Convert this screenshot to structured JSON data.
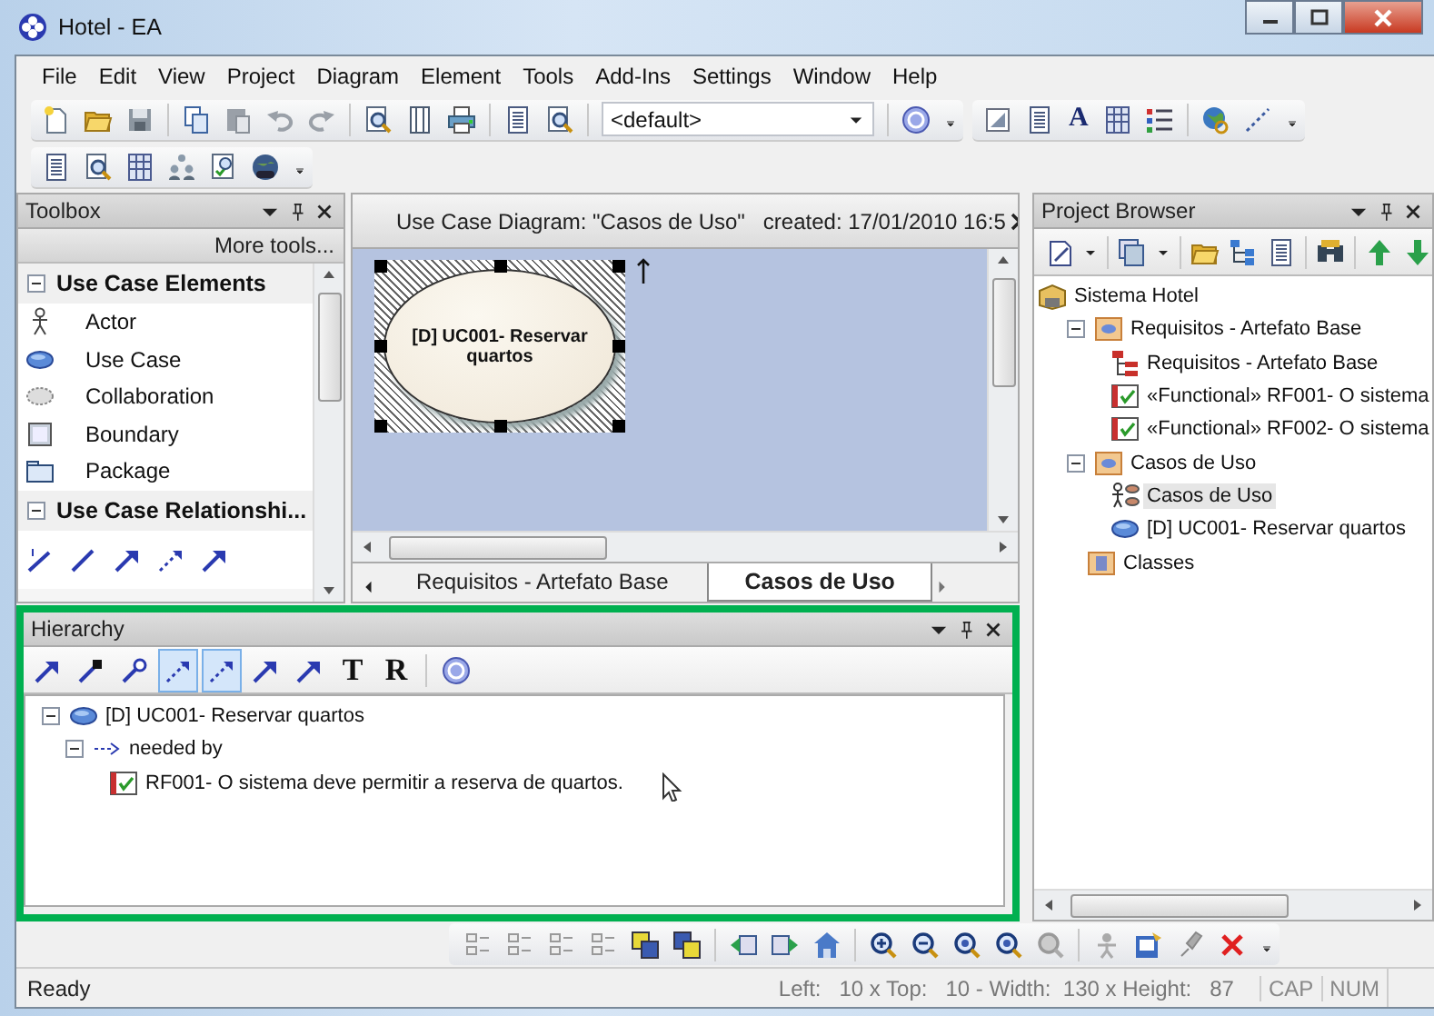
{
  "window": {
    "title": "Hotel - EA"
  },
  "menu": [
    "File",
    "Edit",
    "View",
    "Project",
    "Diagram",
    "Element",
    "Tools",
    "Add-Ins",
    "Settings",
    "Window",
    "Help"
  ],
  "toolbar": {
    "perspective": {
      "value": "<default>"
    },
    "letter_button": "A"
  },
  "toolbox": {
    "title": "Toolbox",
    "more_tools": "More tools...",
    "sections": [
      {
        "title": "Use Case Elements",
        "expanded": true,
        "items": [
          {
            "label": "Actor",
            "kind": "actor"
          },
          {
            "label": "Use Case",
            "kind": "usecase"
          },
          {
            "label": "Collaboration",
            "kind": "collaboration"
          },
          {
            "label": "Boundary",
            "kind": "boundary"
          },
          {
            "label": "Package",
            "kind": "package"
          }
        ]
      },
      {
        "title": "Use Case Relationshi...",
        "expanded": true
      }
    ]
  },
  "diagram": {
    "title": "Use Case Diagram: \"Casos de Uso\"   created: 17/01/2010 16:5",
    "element": {
      "label": "[D] UC001- Reservar quartos",
      "selected": true
    },
    "tabs": [
      {
        "label": "Requisitos - Artefato Base",
        "selected": false
      },
      {
        "label": "Casos de Uso",
        "selected": true
      }
    ]
  },
  "project_browser": {
    "title": "Project Browser",
    "tree": [
      {
        "label": "Sistema Hotel",
        "kind": "model",
        "selected": false,
        "children": [
          {
            "label": "Requisitos - Artefato Base",
            "kind": "package",
            "selected": false,
            "expanded": true,
            "children": [
              {
                "label": "Requisitos - Artefato Base",
                "kind": "diagram",
                "selected": false
              },
              {
                "label": "«Functional» RF001- O sistema",
                "kind": "requirement",
                "selected": false
              },
              {
                "label": "«Functional» RF002- O sistema",
                "kind": "requirement",
                "selected": false
              }
            ]
          },
          {
            "label": "Casos de Uso",
            "kind": "package",
            "selected": false,
            "expanded": true,
            "children": [
              {
                "label": "Casos de Uso",
                "kind": "usecase_diagram",
                "selected": true
              },
              {
                "label": "[D] UC001- Reservar quartos",
                "kind": "usecase",
                "selected": false
              }
            ]
          },
          {
            "label": "Classes",
            "kind": "class_package",
            "selected": false
          }
        ]
      }
    ]
  },
  "hierarchy": {
    "title": "Hierarchy",
    "toolbar": [
      {
        "kind": "arrow",
        "selected": false
      },
      {
        "kind": "arrow_filled",
        "selected": false
      },
      {
        "kind": "arrow_key",
        "selected": false
      },
      {
        "kind": "dashed_arrow",
        "selected": true
      },
      {
        "kind": "dashed_arrow",
        "selected": true
      },
      {
        "kind": "arrow",
        "selected": false
      },
      {
        "kind": "arrow",
        "selected": false
      },
      {
        "kind": "letter",
        "label": "T",
        "selected": false
      },
      {
        "kind": "letter",
        "label": "R",
        "selected": false
      },
      {
        "kind": "help",
        "selected": false
      }
    ],
    "tree": [
      {
        "label": "[D] UC001- Reservar quartos",
        "kind": "usecase",
        "expanded": true,
        "children": [
          {
            "label": "needed by",
            "kind": "relation",
            "expanded": true,
            "children": [
              {
                "label": "RF001- O sistema deve permitir a reserva de quartos.",
                "kind": "requirement"
              }
            ]
          }
        ]
      }
    ]
  },
  "status_bar": {
    "message": "Ready",
    "position": "Left:   10 x Top:   10 - Width:  130 x Height:   87",
    "caps": "CAP",
    "num": "NUM"
  }
}
